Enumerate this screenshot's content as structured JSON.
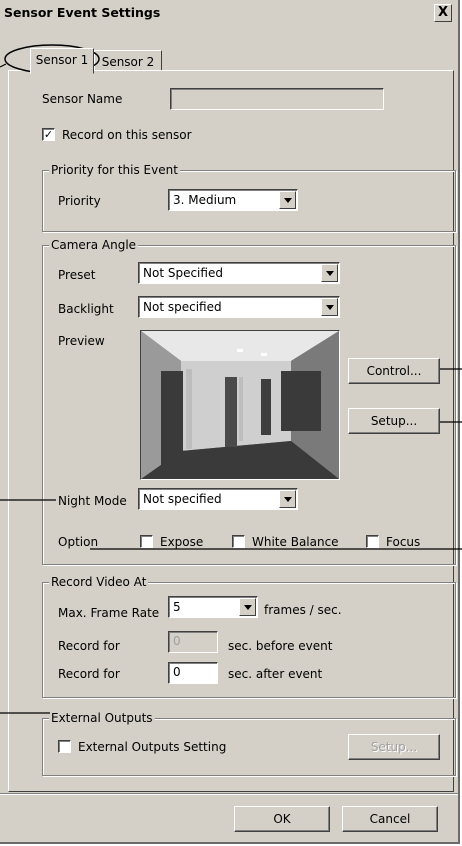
{
  "window": {
    "title": "Sensor Event Settings",
    "close_label": "X"
  },
  "tabs": [
    {
      "label": "Sensor 1"
    },
    {
      "label": "Sensor 2"
    }
  ],
  "sensor_name": {
    "label": "Sensor Name",
    "value": ""
  },
  "record_on_sensor": {
    "label": "Record on this sensor",
    "checked": true
  },
  "priority_group": {
    "legend": "Priority for this Event",
    "label": "Priority",
    "value": "3. Medium"
  },
  "camera_group": {
    "legend": "Camera Angle",
    "preset_label": "Preset",
    "preset_value": "Not Specified",
    "backlight_label": "Backlight",
    "backlight_value": "Not specified",
    "preview_label": "Preview",
    "control_button": "Control...",
    "setup_button": "Setup...",
    "night_mode_label": "Night Mode",
    "night_mode_value": "Not specified",
    "option_label": "Option",
    "options": [
      {
        "label": "Expose"
      },
      {
        "label": "White Balance"
      },
      {
        "label": "Focus"
      }
    ]
  },
  "record_group": {
    "legend": "Record Video At",
    "frame_rate_label": "Max. Frame Rate",
    "frame_rate_value": "5",
    "frame_rate_unit": "frames / sec.",
    "before_label": "Record for",
    "before_value": "0",
    "before_unit": "sec. before event",
    "after_label": "Record for",
    "after_value": "0",
    "after_unit": "sec. after event"
  },
  "external_group": {
    "legend": "External Outputs",
    "checkbox_label": "External Outputs Setting",
    "setup_button": "Setup..."
  },
  "footer": {
    "ok_button": "OK",
    "cancel_button": "Cancel"
  }
}
